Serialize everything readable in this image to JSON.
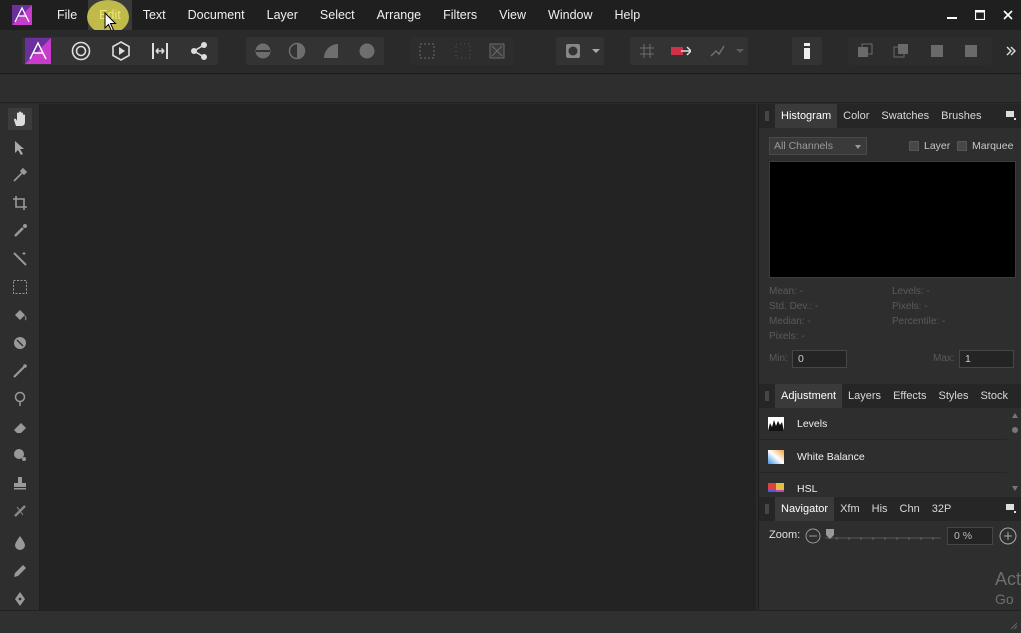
{
  "menu": {
    "items": [
      "File",
      "Edit",
      "Text",
      "Document",
      "Layer",
      "Select",
      "Arrange",
      "Filters",
      "View",
      "Window",
      "Help"
    ],
    "highlighted": "Edit"
  },
  "toolbar": {
    "icons": [
      "persona-photo-icon",
      "persona-liquify-icon",
      "persona-develop-icon",
      "persona-tone-map-icon",
      "persona-export-icon"
    ]
  },
  "colors": {
    "accent_magenta": "#c93ccb",
    "accent_purple": "#6b2f9e",
    "highlight_yellow": "#ece650"
  },
  "panels": {
    "top": {
      "tabs": [
        "Histogram",
        "Color",
        "Swatches",
        "Brushes"
      ],
      "active": "Histogram",
      "channel_select": "All Channels",
      "checkbox_layer": "Layer",
      "checkbox_marquee": "Marquee",
      "stats_left": [
        "Mean: -",
        "Std. Dev.: -",
        "Median: -",
        "Pixels: -"
      ],
      "stats_right": [
        "Levels: -",
        "Pixels: -",
        "Percentile: -"
      ],
      "min_label": "Min:",
      "min_value": "0",
      "max_label": "Max:",
      "max_value": "1"
    },
    "middle": {
      "tabs": [
        "Adjustment",
        "Layers",
        "Effects",
        "Styles",
        "Stock"
      ],
      "active": "Adjustment",
      "items": [
        "Levels",
        "White Balance",
        "HSL"
      ]
    },
    "bottom": {
      "tabs": [
        "Navigator",
        "Xfm",
        "His",
        "Chn",
        "32P"
      ],
      "active": "Navigator",
      "zoom_label": "Zoom:",
      "zoom_value": "0 %"
    }
  },
  "watermark": {
    "line1": "Act",
    "line2": "Go t"
  }
}
